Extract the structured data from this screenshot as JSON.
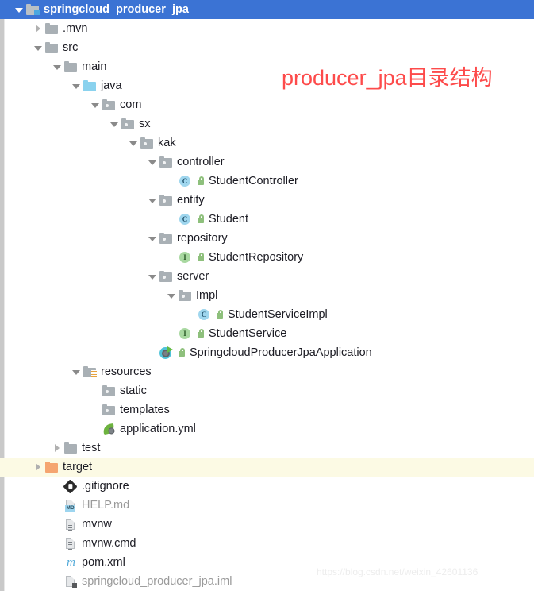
{
  "annotation": {
    "text": "producer_jpa目录结构",
    "color": "#fd4b4b"
  },
  "watermark": {
    "text": "https://blog.csdn.net/weixin_42601136"
  },
  "theme": {
    "selection_blue": "#3b73d4",
    "highlight_yellow": "#fcfae4",
    "folder_grey": "#a9b0b5",
    "folder_source_blue": "#8ad2ee",
    "folder_target_orange": "#f5a570",
    "class_icon_blue": "#9fd6ee",
    "interface_icon_green": "#a8d8a0",
    "spring_green": "#6db33f"
  },
  "tree": {
    "name": "project-tree",
    "rows": [
      {
        "label": "springcloud_producer_jpa",
        "depth": 0,
        "twisty": "open",
        "icon": "module-folder-icon",
        "state": "selected"
      },
      {
        "label": ".mvn",
        "depth": 1,
        "twisty": "closed",
        "icon": "folder-icon",
        "state": "normal"
      },
      {
        "label": "src",
        "depth": 1,
        "twisty": "open",
        "icon": "folder-icon",
        "state": "normal"
      },
      {
        "label": "main",
        "depth": 2,
        "twisty": "open",
        "icon": "folder-icon",
        "state": "normal"
      },
      {
        "label": "java",
        "depth": 3,
        "twisty": "open",
        "icon": "source-folder-icon",
        "state": "normal"
      },
      {
        "label": "com",
        "depth": 4,
        "twisty": "open",
        "icon": "package-folder-icon",
        "state": "normal"
      },
      {
        "label": "sx",
        "depth": 5,
        "twisty": "open",
        "icon": "package-folder-icon",
        "state": "normal"
      },
      {
        "label": "kak",
        "depth": 6,
        "twisty": "open",
        "icon": "package-folder-icon",
        "state": "normal"
      },
      {
        "label": "controller",
        "depth": 7,
        "twisty": "open",
        "icon": "package-folder-icon",
        "state": "normal"
      },
      {
        "label": "StudentController",
        "depth": 8,
        "twisty": "none",
        "icon": "java-class-icon",
        "state": "normal",
        "marker": "public-lock-icon"
      },
      {
        "label": "entity",
        "depth": 7,
        "twisty": "open",
        "icon": "package-folder-icon",
        "state": "normal"
      },
      {
        "label": "Student",
        "depth": 8,
        "twisty": "none",
        "icon": "java-class-icon",
        "state": "normal",
        "marker": "public-lock-icon"
      },
      {
        "label": "repository",
        "depth": 7,
        "twisty": "open",
        "icon": "package-folder-icon",
        "state": "normal"
      },
      {
        "label": "StudentRepository",
        "depth": 8,
        "twisty": "none",
        "icon": "java-interface-icon",
        "state": "normal",
        "marker": "public-lock-icon"
      },
      {
        "label": "server",
        "depth": 7,
        "twisty": "open",
        "icon": "package-folder-icon",
        "state": "normal"
      },
      {
        "label": "Impl",
        "depth": 8,
        "twisty": "open",
        "icon": "package-folder-icon",
        "state": "normal"
      },
      {
        "label": "StudentServiceImpl",
        "depth": 9,
        "twisty": "none",
        "icon": "java-class-icon",
        "state": "normal",
        "marker": "public-lock-icon"
      },
      {
        "label": "StudentService",
        "depth": 8,
        "twisty": "none",
        "icon": "java-interface-icon",
        "state": "normal",
        "marker": "public-lock-icon"
      },
      {
        "label": "SpringcloudProducerJpaApplication",
        "depth": 7,
        "twisty": "none",
        "icon": "spring-boot-app-icon",
        "state": "normal",
        "marker": "public-lock-icon"
      },
      {
        "label": "resources",
        "depth": 3,
        "twisty": "open",
        "icon": "resources-folder-icon",
        "state": "normal"
      },
      {
        "label": "static",
        "depth": 4,
        "twisty": "none",
        "icon": "package-folder-icon",
        "state": "normal"
      },
      {
        "label": "templates",
        "depth": 4,
        "twisty": "none",
        "icon": "package-folder-icon",
        "state": "normal"
      },
      {
        "label": "application.yml",
        "depth": 4,
        "twisty": "none",
        "icon": "spring-leaf-icon",
        "state": "normal"
      },
      {
        "label": "test",
        "depth": 2,
        "twisty": "closed",
        "icon": "folder-icon",
        "state": "normal"
      },
      {
        "label": "target",
        "depth": 1,
        "twisty": "closed",
        "icon": "excluded-folder-icon",
        "state": "highlight"
      },
      {
        "label": ".gitignore",
        "depth": 2,
        "twisty": "none",
        "icon": "git-file-icon",
        "state": "normal"
      },
      {
        "label": "HELP.md",
        "depth": 2,
        "twisty": "none",
        "icon": "markdown-file-icon",
        "state": "muted"
      },
      {
        "label": "mvnw",
        "depth": 2,
        "twisty": "none",
        "icon": "text-file-icon",
        "state": "normal"
      },
      {
        "label": "mvnw.cmd",
        "depth": 2,
        "twisty": "none",
        "icon": "text-file-icon",
        "state": "normal"
      },
      {
        "label": "pom.xml",
        "depth": 2,
        "twisty": "none",
        "icon": "maven-file-icon",
        "state": "normal"
      },
      {
        "label": "springcloud_producer_jpa.iml",
        "depth": 2,
        "twisty": "none",
        "icon": "iml-file-icon",
        "state": "muted"
      }
    ]
  }
}
